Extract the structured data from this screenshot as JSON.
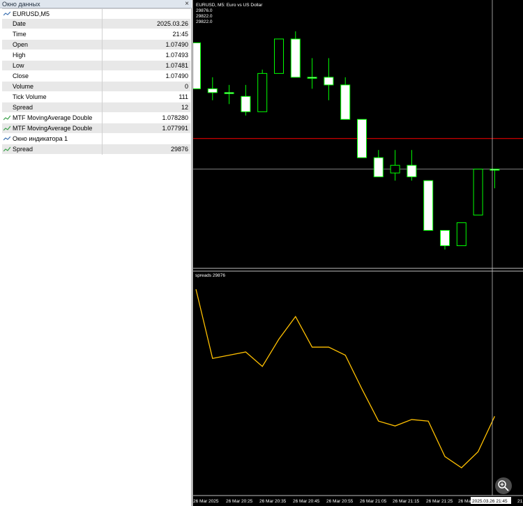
{
  "data_window": {
    "title": "Окно данных",
    "close_glyph": "×",
    "symbol_header": "EURUSD,M5",
    "rows": [
      {
        "label": "Date",
        "value": "2025.03.26"
      },
      {
        "label": "Time",
        "value": "21:45"
      },
      {
        "label": "Open",
        "value": "1.07490"
      },
      {
        "label": "High",
        "value": "1.07493"
      },
      {
        "label": "Low",
        "value": "1.07481"
      },
      {
        "label": "Close",
        "value": "1.07490"
      },
      {
        "label": "Volume",
        "value": "0"
      },
      {
        "label": "Tick Volume",
        "value": "111"
      },
      {
        "label": "Spread",
        "value": "12"
      },
      {
        "label": "MTF MovingAverage Double",
        "value": "1.078280",
        "icon": "indicator-icon"
      },
      {
        "label": "MTF MovingAverage Double",
        "value": "1.077991",
        "icon": "indicator-icon"
      }
    ],
    "subwindow_header": "Окно индикатора 1",
    "subwindow_rows": [
      {
        "label": "Spread",
        "value": "29876",
        "icon": "indicator-icon"
      }
    ]
  },
  "main_chart": {
    "title": "EURUSD, M5:  Euro vs US Dollar",
    "readouts": [
      "29876.0",
      "29822.0",
      "29822.0"
    ],
    "bull_color": "#00ff00",
    "bear_body_color": "#ffffff",
    "red_line_color": "#ff0000",
    "grey_line_color": "#808080"
  },
  "sub_chart": {
    "label": "spreads 29876",
    "line_color": "#ffc000"
  },
  "time_axis": {
    "labels": [
      "26 Mar 2025",
      "26 Mar 20:25",
      "26 Mar 20:35",
      "26 Mar 20:45",
      "26 Mar 20:55",
      "26 Mar 21:05",
      "26 Mar 21:15",
      "26 Mar 21:25",
      "26 Mar",
      "21:45"
    ],
    "crosshair_label": "2025.03.26 21:45"
  },
  "chart_data": [
    {
      "type": "candlestick",
      "series": [
        {
          "name": "EURUSD",
          "values": [
            {
              "o": 1.0773,
              "h": 1.0773,
              "l": 1.0761,
              "c": 1.0761
            },
            {
              "o": 1.0761,
              "h": 1.0764,
              "l": 1.0758,
              "c": 1.076
            },
            {
              "o": 1.076,
              "h": 1.0762,
              "l": 1.0757,
              "c": 1.076
            },
            {
              "o": 1.0759,
              "h": 1.0762,
              "l": 1.0754,
              "c": 1.0755
            },
            {
              "o": 1.0755,
              "h": 1.0766,
              "l": 1.0755,
              "c": 1.0765
            },
            {
              "o": 1.0765,
              "h": 1.0774,
              "l": 1.0765,
              "c": 1.0774
            },
            {
              "o": 1.0774,
              "h": 1.0776,
              "l": 1.0764,
              "c": 1.0764
            },
            {
              "o": 1.0764,
              "h": 1.0769,
              "l": 1.0761,
              "c": 1.0764
            },
            {
              "o": 1.0764,
              "h": 1.0769,
              "l": 1.0758,
              "c": 1.0762
            },
            {
              "o": 1.0762,
              "h": 1.0764,
              "l": 1.0753,
              "c": 1.0753
            },
            {
              "o": 1.0753,
              "h": 1.0753,
              "l": 1.0743,
              "c": 1.0743
            },
            {
              "o": 1.0743,
              "h": 1.0745,
              "l": 1.0738,
              "c": 1.0738
            },
            {
              "o": 1.0739,
              "h": 1.0745,
              "l": 1.0737,
              "c": 1.0741
            },
            {
              "o": 1.0741,
              "h": 1.0745,
              "l": 1.0737,
              "c": 1.0738
            },
            {
              "o": 1.0737,
              "h": 1.0737,
              "l": 1.0724,
              "c": 1.0724
            },
            {
              "o": 1.0724,
              "h": 1.0724,
              "l": 1.0719,
              "c": 1.072
            },
            {
              "o": 1.072,
              "h": 1.0726,
              "l": 1.072,
              "c": 1.0726
            },
            {
              "o": 1.0728,
              "h": 1.074,
              "l": 1.0728,
              "c": 1.074
            },
            {
              "o": 1.074,
              "h": 1.074,
              "l": 1.0735,
              "c": 1.074
            }
          ]
        }
      ],
      "hlines": [
        1.0748,
        1.074
      ],
      "ylim": [
        1.0715,
        1.0782
      ]
    },
    {
      "type": "line",
      "title": "spreads 29876",
      "series": [
        {
          "name": "spreads",
          "values": [
            29905,
            29862,
            29864,
            29866,
            29857,
            29874,
            29888,
            29869,
            29869,
            29864,
            29843,
            29823,
            29820,
            29824,
            29823,
            29801,
            29794,
            29804,
            29826
          ]
        }
      ],
      "ylim": [
        29788,
        29905
      ]
    }
  ]
}
